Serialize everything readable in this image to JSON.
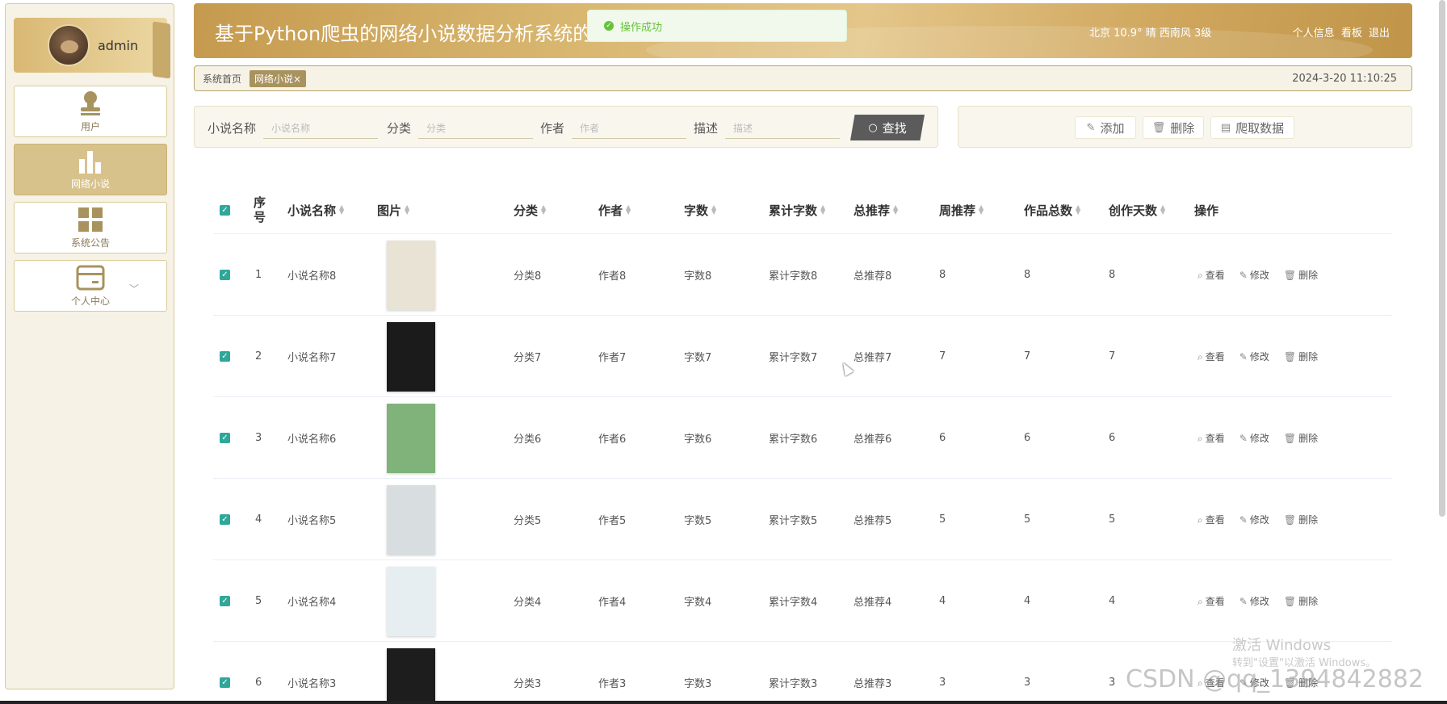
{
  "user": {
    "name": "admin"
  },
  "sidebar": {
    "items": [
      {
        "label": "用户",
        "icon": "user-icon"
      },
      {
        "label": "网络小说",
        "icon": "bar-chart-icon"
      },
      {
        "label": "系统公告",
        "icon": "grid-icon"
      },
      {
        "label": "个人中心",
        "icon": "card-icon"
      }
    ]
  },
  "header": {
    "title": "基于Python爬虫的网络小说数据分析系统的设",
    "weather": "北京  10.9°  晴  西南风  3级",
    "links": [
      "个人信息",
      "看板",
      "退出"
    ]
  },
  "toast": {
    "text": "操作成功"
  },
  "breadcrumb": {
    "home": "系统首页",
    "tag": "网络小说×",
    "time": "2024-3-20 11:10:25"
  },
  "search": {
    "fields": [
      {
        "label": "小说名称",
        "placeholder": "小说名称"
      },
      {
        "label": "分类",
        "placeholder": "分类"
      },
      {
        "label": "作者",
        "placeholder": "作者"
      },
      {
        "label": "描述",
        "placeholder": "描述"
      }
    ],
    "button": "查找"
  },
  "actions": {
    "add": "添加",
    "delete": "删除",
    "crawl": "爬取数据"
  },
  "table": {
    "headers": [
      "序号",
      "小说名称",
      "图片",
      "分类",
      "作者",
      "字数",
      "累计字数",
      "总推荐",
      "周推荐",
      "作品总数",
      "创作天数",
      "操作"
    ],
    "ops": [
      "查看",
      "修改",
      "删除"
    ],
    "rows": [
      {
        "index": "1",
        "name": "小说名称8",
        "category": "分类8",
        "author": "作者8",
        "words": "字数8",
        "total_words": "累计字数8",
        "total_rec": "总推荐8",
        "week_rec": "8",
        "works": "8",
        "days": "8",
        "cover": "#e9e3d6"
      },
      {
        "index": "2",
        "name": "小说名称7",
        "category": "分类7",
        "author": "作者7",
        "words": "字数7",
        "total_words": "累计字数7",
        "total_rec": "总推荐7",
        "week_rec": "7",
        "works": "7",
        "days": "7",
        "cover": "#1b1b1b"
      },
      {
        "index": "3",
        "name": "小说名称6",
        "category": "分类6",
        "author": "作者6",
        "words": "字数6",
        "total_words": "累计字数6",
        "total_rec": "总推荐6",
        "week_rec": "6",
        "works": "6",
        "days": "6",
        "cover": "#7fb37a"
      },
      {
        "index": "4",
        "name": "小说名称5",
        "category": "分类5",
        "author": "作者5",
        "words": "字数5",
        "total_words": "累计字数5",
        "total_rec": "总推荐5",
        "week_rec": "5",
        "works": "5",
        "days": "5",
        "cover": "#d8dde0"
      },
      {
        "index": "5",
        "name": "小说名称4",
        "category": "分类4",
        "author": "作者4",
        "words": "字数4",
        "total_words": "累计字数4",
        "total_rec": "总推荐4",
        "week_rec": "4",
        "works": "4",
        "days": "4",
        "cover": "#e6eef2"
      },
      {
        "index": "6",
        "name": "小说名称3",
        "category": "分类3",
        "author": "作者3",
        "words": "字数3",
        "total_words": "累计字数3",
        "total_rec": "总推荐3",
        "week_rec": "3",
        "works": "3",
        "days": "3",
        "cover": "#1d1d1d"
      }
    ]
  },
  "overlay": {
    "activate_title": "激活 Windows",
    "activate_sub": "转到\"设置\"以激活 Windows。",
    "csdn": "CSDN @qq_1394842882"
  },
  "colors": {
    "accent": "#d7c28c",
    "header": "#d4b06a",
    "checkbox": "#2fa79a",
    "toast_text": "#67c23a"
  }
}
